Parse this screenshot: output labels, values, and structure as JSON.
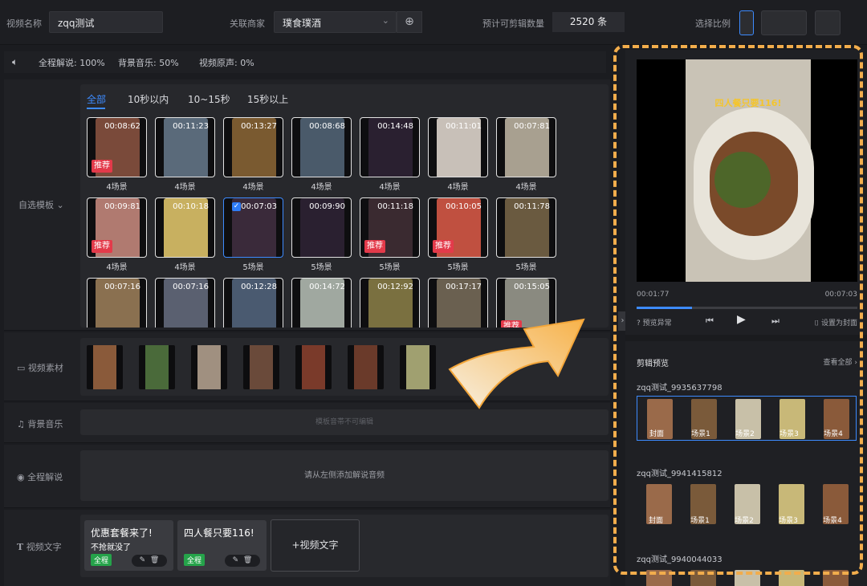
{
  "header": {
    "video_name_label": "视频名称",
    "video_name_value": "zqq测试",
    "merchant_label": "关联商家",
    "merchant_value": "璞食璞酒",
    "estimate_label": "预计可剪辑数量",
    "estimate_value": "2520 条",
    "ratio_label": "选择比例"
  },
  "status": {
    "narration": "全程解说: 100%",
    "bgm": "背景音乐: 50%",
    "original": "视频原声: 0%"
  },
  "template": {
    "row_label": "自选模板",
    "tabs": [
      "全部",
      "10秒以内",
      "10~15秒",
      "15秒以上"
    ],
    "items": [
      {
        "duration": "00:08:62",
        "scene": "4场景",
        "recommended": true,
        "selected": false,
        "color": "#7a4a3a"
      },
      {
        "duration": "00:11:23",
        "scene": "4场景",
        "recommended": false,
        "selected": false,
        "color": "#5a6a7a"
      },
      {
        "duration": "00:13:27",
        "scene": "4场景",
        "recommended": false,
        "selected": false,
        "color": "#7a5a30"
      },
      {
        "duration": "00:08:68",
        "scene": "4场景",
        "recommended": false,
        "selected": false,
        "color": "#4a5a6a"
      },
      {
        "duration": "00:14:48",
        "scene": "4场景",
        "recommended": false,
        "selected": false,
        "color": "#2a2030"
      },
      {
        "duration": "00:11:01",
        "scene": "4场景",
        "recommended": false,
        "selected": false,
        "color": "#c8c0b8"
      },
      {
        "duration": "00:07:81",
        "scene": "4场景",
        "recommended": false,
        "selected": false,
        "color": "#a8a090"
      },
      {
        "duration": "00:09:81",
        "scene": "4场景",
        "recommended": true,
        "selected": false,
        "color": "#b07a70"
      },
      {
        "duration": "00:10:18",
        "scene": "4场景",
        "recommended": false,
        "selected": false,
        "color": "#c8b060"
      },
      {
        "duration": "00:07:03",
        "scene": "5场景",
        "recommended": false,
        "selected": true,
        "color": "#3a2a3a"
      },
      {
        "duration": "00:09:90",
        "scene": "5场景",
        "recommended": false,
        "selected": false,
        "color": "#2a2030"
      },
      {
        "duration": "00:11:18",
        "scene": "5场景",
        "recommended": true,
        "selected": false,
        "color": "#3a2a30"
      },
      {
        "duration": "00:10:05",
        "scene": "5场景",
        "recommended": true,
        "selected": false,
        "color": "#c05040"
      },
      {
        "duration": "00:11:78",
        "scene": "5场景",
        "recommended": false,
        "selected": false,
        "color": "#6a5a40"
      },
      {
        "duration": "00:07:16",
        "scene": "",
        "recommended": false,
        "selected": false,
        "color": "#8a7050"
      },
      {
        "duration": "00:07:16",
        "scene": "",
        "recommended": false,
        "selected": false,
        "color": "#5a6070"
      },
      {
        "duration": "00:12:28",
        "scene": "",
        "recommended": false,
        "selected": false,
        "color": "#4a5a70"
      },
      {
        "duration": "00:14:72",
        "scene": "",
        "recommended": false,
        "selected": false,
        "color": "#a0a8a0"
      },
      {
        "duration": "00:12:92",
        "scene": "",
        "recommended": false,
        "selected": false,
        "color": "#7a7040"
      },
      {
        "duration": "00:17:17",
        "scene": "",
        "recommended": false,
        "selected": false,
        "color": "#6a6050"
      },
      {
        "duration": "00:15:05",
        "scene": "",
        "recommended": true,
        "selected": false,
        "color": "#8a8a80"
      }
    ]
  },
  "material": {
    "row_label": "视频素材",
    "colors": [
      "#8a5a3a",
      "#4a6a3a",
      "#a09080",
      "#6a4a3a",
      "#7a3a2a",
      "#6a3a2a",
      "#a0a070"
    ]
  },
  "bgm": {
    "row_label": "背景音乐",
    "placeholder": "模板音帯不可编辑"
  },
  "narration": {
    "row_label": "全程解说",
    "placeholder": "请从左侧添加解说音频"
  },
  "texts": {
    "row_label": "视频文字",
    "cards": [
      {
        "line1": "优惠套餐来了!",
        "line2": "不抢就没了",
        "tag": "全程"
      },
      {
        "line1": "四人餐只要116!",
        "line2": "",
        "tag": "全程"
      }
    ],
    "add_label": "+视频文字"
  },
  "preview": {
    "caption": "四人餐只要116!",
    "current_time": "00:01:77",
    "total_time": "00:07:03",
    "progress": 0.25,
    "report_label": "预览异常",
    "cover_label": "设置为封面",
    "section_title": "剪辑预览",
    "view_all": "查看全部",
    "clips": [
      {
        "name": "zqq测试_9935637798",
        "labels": [
          "封面",
          "场景1",
          "场景2",
          "场景3",
          "场景4"
        ],
        "selected": true
      },
      {
        "name": "zqq测试_9941415812",
        "labels": [
          "封面",
          "场景1",
          "场景2",
          "场景3",
          "场景4"
        ],
        "selected": false
      },
      {
        "name": "zqq测试_9940044033",
        "labels": [],
        "selected": false
      }
    ]
  }
}
